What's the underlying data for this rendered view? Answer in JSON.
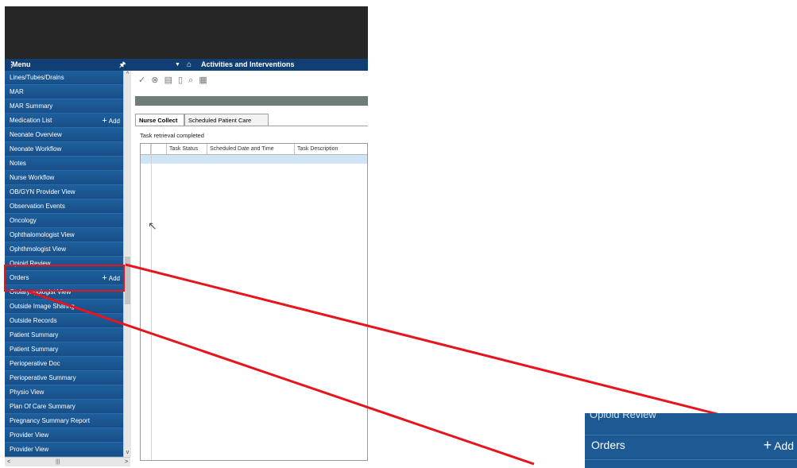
{
  "sidebar": {
    "header_title": "Menu",
    "items": [
      {
        "label": "Lines/Tubes/Drains"
      },
      {
        "label": "MAR"
      },
      {
        "label": "MAR Summary"
      },
      {
        "label": "Medication List",
        "add": "Add"
      },
      {
        "label": "Neonate Overview"
      },
      {
        "label": "Neonate Workflow"
      },
      {
        "label": "Notes"
      },
      {
        "label": "Nurse Workflow"
      },
      {
        "label": "OB/GYN Provider View"
      },
      {
        "label": "Observation Events"
      },
      {
        "label": "Oncology"
      },
      {
        "label": "Ophthalomologist View"
      },
      {
        "label": "Ophthmologist View"
      },
      {
        "label": "Opioid Review"
      },
      {
        "label": "Orders",
        "add": "Add"
      },
      {
        "label": "Otolaryngologist View"
      },
      {
        "label": "Outside Image Sharing"
      },
      {
        "label": "Outside Records"
      },
      {
        "label": "Patient Summary"
      },
      {
        "label": "Patient Summary"
      },
      {
        "label": "Perioperative Doc"
      },
      {
        "label": "Perioperative Summary"
      },
      {
        "label": "Physio View"
      },
      {
        "label": "Plan Of Care Summary"
      },
      {
        "label": "Pregnancy Summary Report"
      },
      {
        "label": "Provider View"
      },
      {
        "label": "Provider View"
      }
    ]
  },
  "pane": {
    "title": "Activities and Interventions",
    "tabs": [
      "Nurse Collect",
      "Scheduled Patient Care"
    ],
    "status_message": "Task retrieval completed",
    "columns": [
      "Task Status",
      "Scheduled Date and Time",
      "Task Description"
    ]
  },
  "zoom": {
    "partial_label": "Opioid Review",
    "label": "Orders",
    "add": "Add"
  },
  "colors": {
    "sidebar_bg": "#1c5a96",
    "header_bg": "#123f73",
    "highlight": "#e8141c"
  }
}
